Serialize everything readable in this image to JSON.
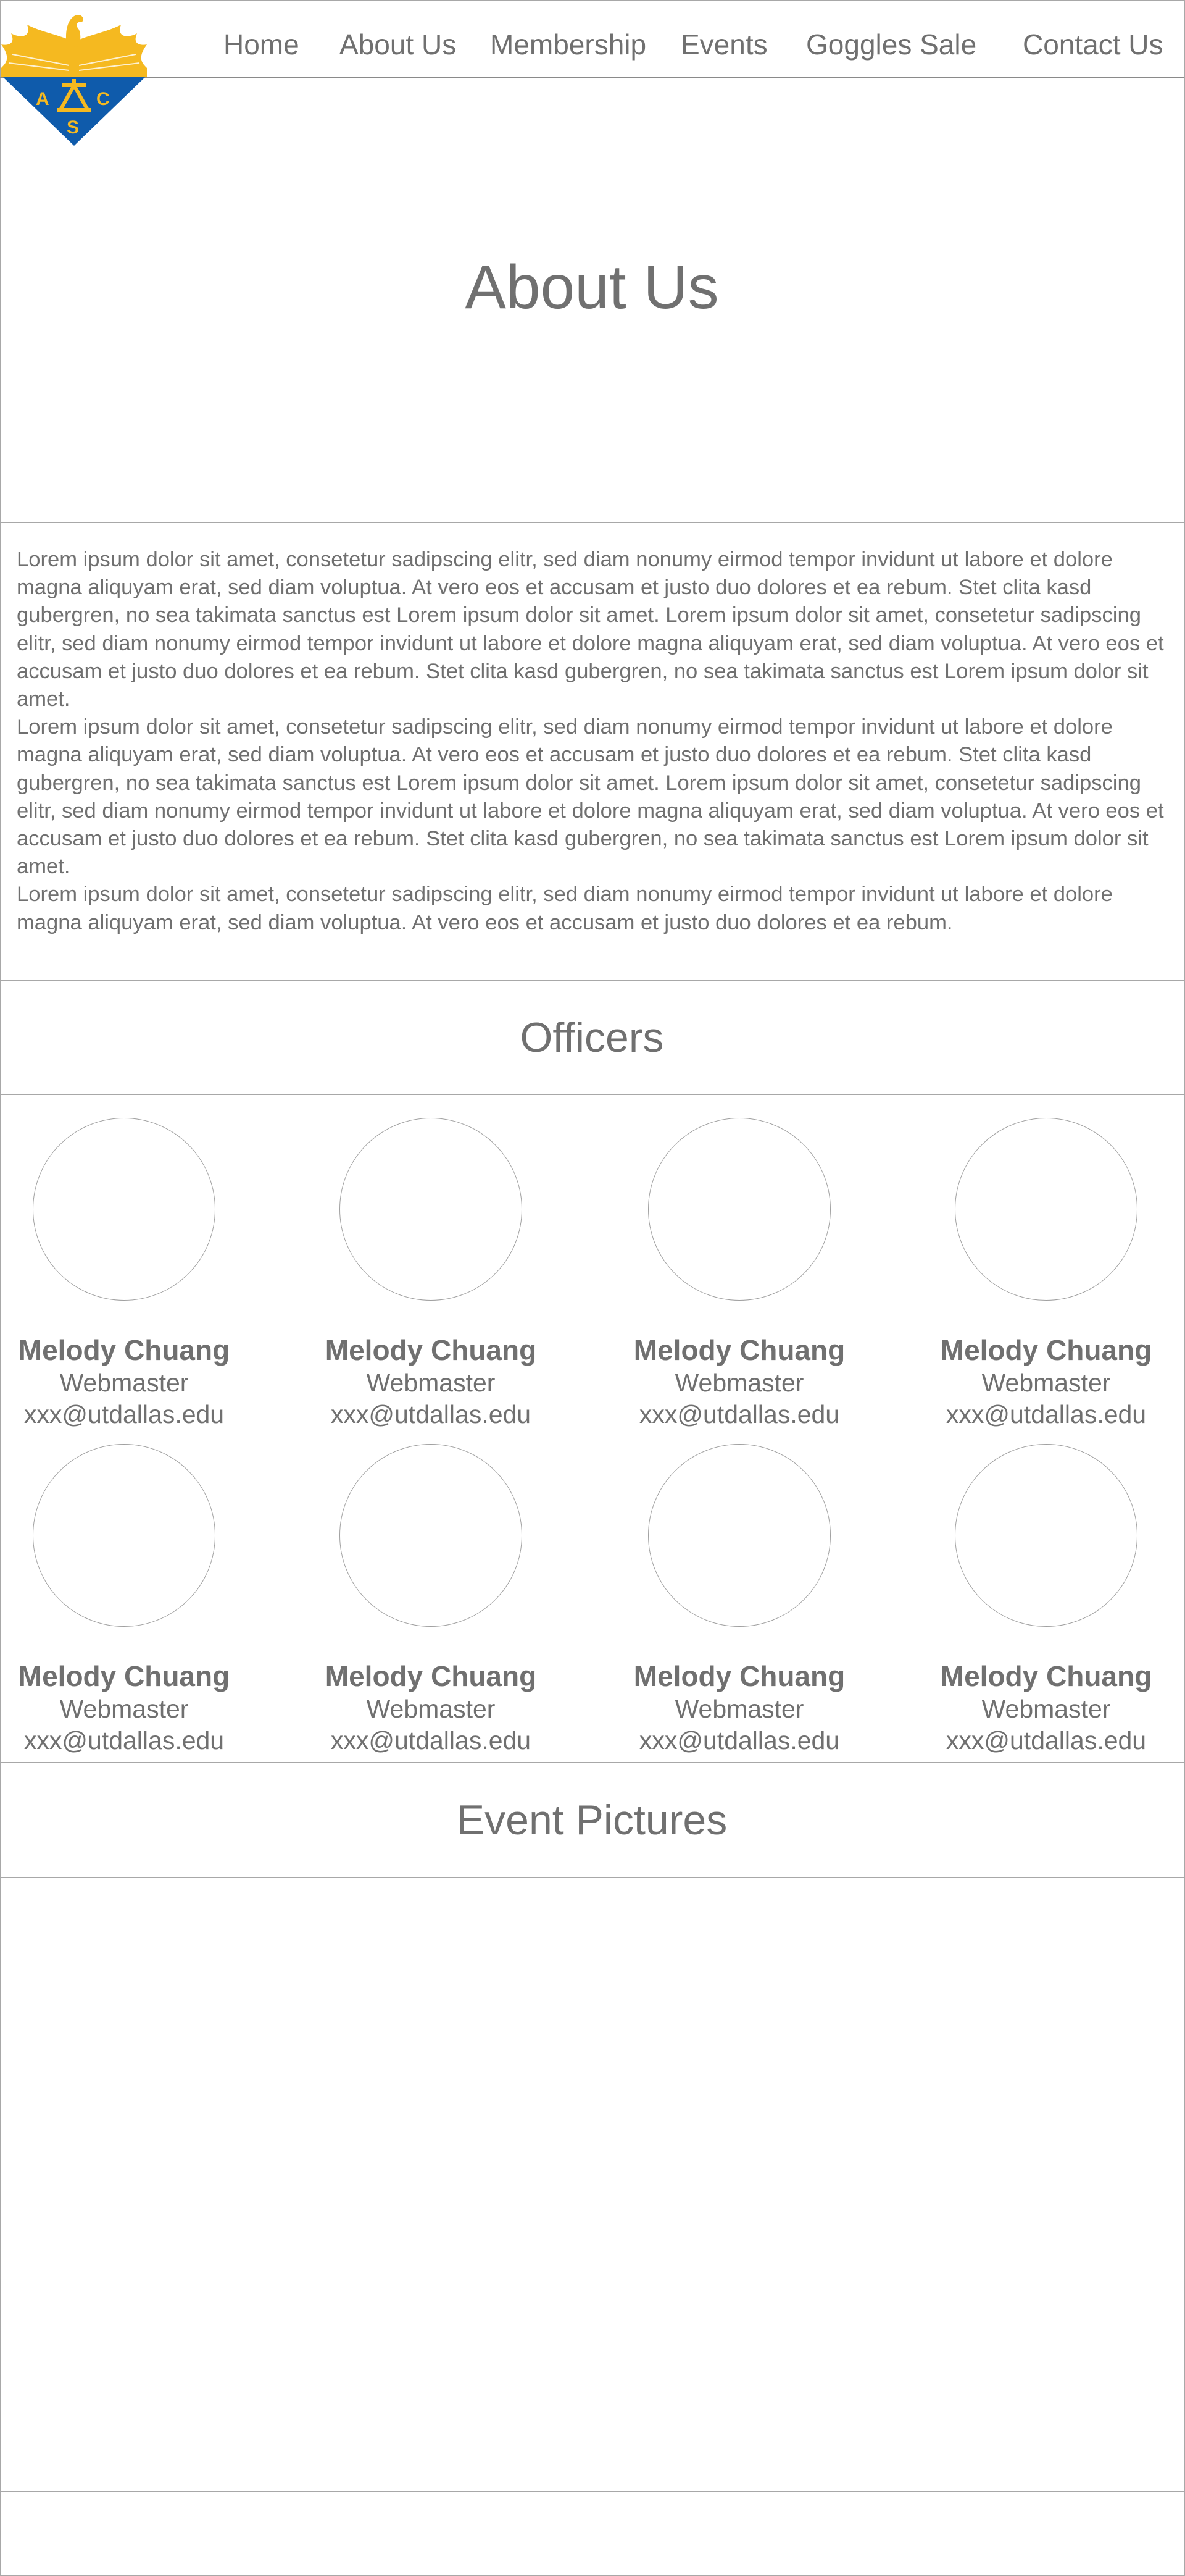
{
  "nav": {
    "items": [
      {
        "label": "Home"
      },
      {
        "label": "About Us"
      },
      {
        "label": "Membership"
      },
      {
        "label": "Events"
      },
      {
        "label": "Goggles Sale"
      },
      {
        "label": "Contact Us"
      }
    ]
  },
  "logo": {
    "letters": [
      "A",
      "C",
      "S"
    ],
    "colors": {
      "gold": "#f5b920",
      "blue": "#0f5bab"
    }
  },
  "hero": {
    "title": "About Us"
  },
  "content": {
    "paragraphs": [
      "Lorem ipsum dolor sit amet, consetetur sadipscing elitr, sed diam nonumy eirmod tempor invidunt ut labore et dolore magna aliquyam erat, sed diam voluptua. At vero eos et accusam et justo duo dolores et ea rebum. Stet clita kasd gubergren, no sea takimata sanctus est Lorem ipsum dolor sit amet. Lorem ipsum dolor sit amet, consetetur sadipscing elitr, sed diam nonumy eirmod tempor invidunt ut labore et dolore magna aliquyam erat, sed diam voluptua. At vero eos et accusam et justo duo dolores et ea rebum. Stet clita kasd gubergren, no sea takimata sanctus est Lorem ipsum dolor sit amet.",
      "Lorem ipsum dolor sit amet, consetetur sadipscing elitr, sed diam nonumy eirmod tempor invidunt ut labore et dolore magna aliquyam erat, sed diam voluptua. At vero eos et accusam et justo duo dolores et ea rebum. Stet clita kasd gubergren, no sea takimata sanctus est Lorem ipsum dolor sit amet. Lorem ipsum dolor sit amet, consetetur sadipscing elitr, sed diam nonumy eirmod tempor invidunt ut labore et dolore magna aliquyam erat, sed diam voluptua. At vero eos et accusam et justo duo dolores et ea rebum. Stet clita kasd gubergren, no sea takimata sanctus est Lorem ipsum dolor sit amet.",
      "Lorem ipsum dolor sit amet, consetetur sadipscing elitr, sed diam nonumy eirmod tempor invidunt ut labore et dolore magna aliquyam erat, sed diam voluptua. At vero eos et accusam et justo duo dolores et ea rebum."
    ]
  },
  "officers": {
    "title": "Officers",
    "items": [
      {
        "name": "Melody Chuang",
        "role": "Webmaster",
        "email": "xxx@utdallas.edu"
      },
      {
        "name": "Melody Chuang",
        "role": "Webmaster",
        "email": "xxx@utdallas.edu"
      },
      {
        "name": "Melody Chuang",
        "role": "Webmaster",
        "email": "xxx@utdallas.edu"
      },
      {
        "name": "Melody Chuang",
        "role": "Webmaster",
        "email": "xxx@utdallas.edu"
      },
      {
        "name": "Melody Chuang",
        "role": "Webmaster",
        "email": "xxx@utdallas.edu"
      },
      {
        "name": "Melody Chuang",
        "role": "Webmaster",
        "email": "xxx@utdallas.edu"
      },
      {
        "name": "Melody Chuang",
        "role": "Webmaster",
        "email": "xxx@utdallas.edu"
      },
      {
        "name": "Melody Chuang",
        "role": "Webmaster",
        "email": "xxx@utdallas.edu"
      }
    ]
  },
  "events": {
    "title": "Event Pictures"
  }
}
